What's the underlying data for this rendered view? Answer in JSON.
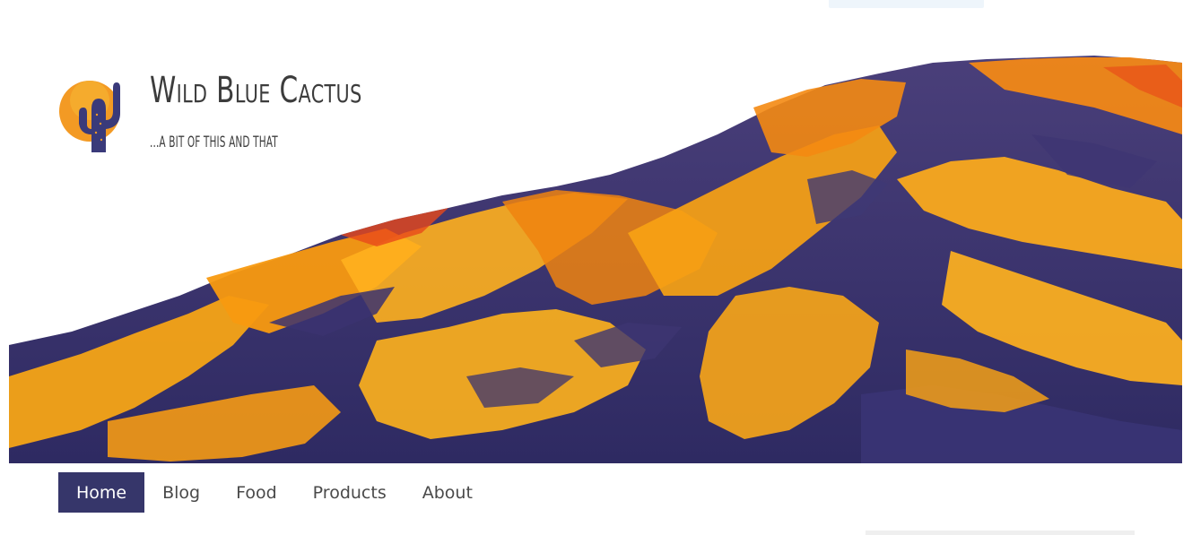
{
  "site": {
    "title": "Wild Blue Cactus",
    "tagline": "...a bit of this and that"
  },
  "nav": {
    "items": [
      {
        "label": "Home",
        "active": true
      },
      {
        "label": "Blog",
        "active": false
      },
      {
        "label": "Food",
        "active": false
      },
      {
        "label": "Products",
        "active": false
      },
      {
        "label": "About",
        "active": false
      }
    ]
  },
  "colors": {
    "nav_active_bg": "#36366a",
    "mountain_orange": "#f5a014",
    "mountain_purple": "#3b3370",
    "sun_orange": "#f39a24",
    "cactus_blue": "#3a3a7a"
  },
  "icons": {
    "logo": "cactus-sun-logo-icon"
  }
}
